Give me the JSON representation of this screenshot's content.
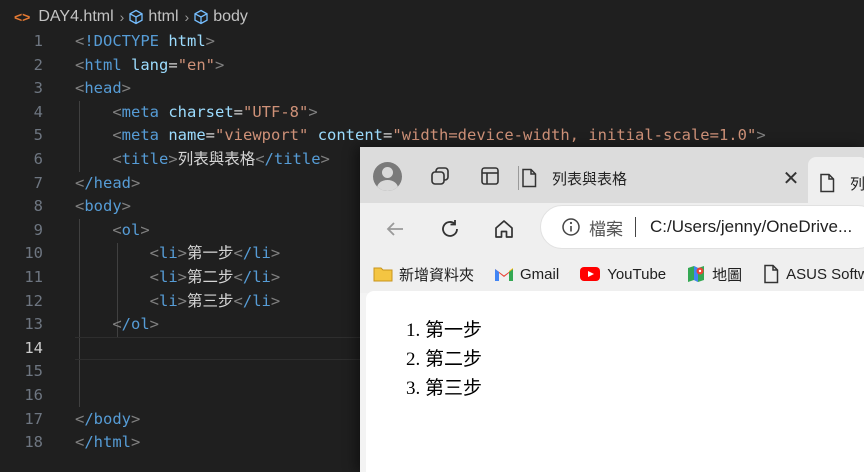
{
  "breadcrumb": {
    "file": "DAY4.html",
    "crumb2": "html",
    "crumb3": "body"
  },
  "editor": {
    "active_line": 14,
    "line_numbers": [
      "1",
      "2",
      "3",
      "4",
      "5",
      "6",
      "7",
      "8",
      "9",
      "10",
      "11",
      "12",
      "13",
      "14",
      "15",
      "16",
      "17",
      "18"
    ]
  },
  "code": {
    "l1_doctype": "!DOCTYPE",
    "l1_html": "html",
    "l2_tag": "html",
    "l2_attr": "lang",
    "l2_val": "\"en\"",
    "l3_tag": "head",
    "l4_tag": "meta",
    "l4_attr": "charset",
    "l4_val": "\"UTF-8\"",
    "l5_tag": "meta",
    "l5_attr1": "name",
    "l5_val1": "\"viewport\"",
    "l5_attr2": "content",
    "l5_val2": "\"width=device-width, initial-scale=1.0\"",
    "l6_tag": "title",
    "l6_text": "列表與表格",
    "l6_close": "/title",
    "l7_tag": "/head",
    "l8_tag": "body",
    "l9_tag": "ol",
    "l10_tag": "li",
    "l10_text": "第一步",
    "l10_close": "/li",
    "l11_tag": "li",
    "l11_text": "第二步",
    "l11_close": "/li",
    "l12_tag": "li",
    "l12_text": "第三步",
    "l12_close": "/li",
    "l13_tag": "/ol",
    "l17_tag": "/body",
    "l18_tag": "/html"
  },
  "browser": {
    "tab_title": "列表與表格",
    "tab_close": "✕",
    "next_tab_title": "列",
    "omnibox": {
      "label": "檔案",
      "url": "C:/Users/jenny/OneDrive..."
    },
    "bookmarks": [
      "新增資料夾",
      "Gmail",
      "YouTube",
      "地圖",
      "ASUS Softw"
    ],
    "page": {
      "items": [
        "第一步",
        "第二步",
        "第三步"
      ],
      "markers": [
        "1.",
        "2.",
        "3."
      ]
    }
  },
  "colors": {
    "editor_bg": "#1f1f1f",
    "tag": "#569cd6",
    "attr": "#9cdcfe",
    "string": "#ce9178",
    "bracket": "#808080"
  }
}
